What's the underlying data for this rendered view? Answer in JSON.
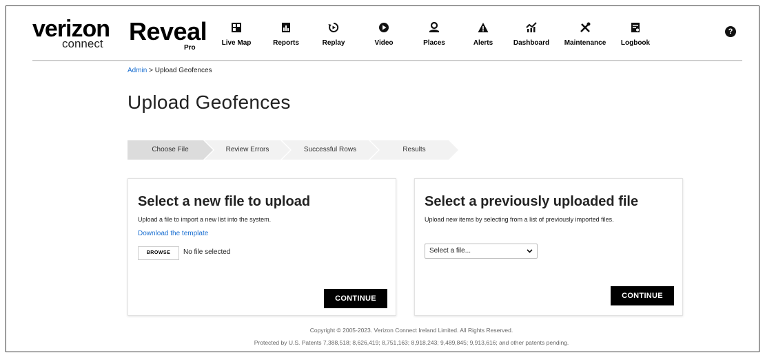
{
  "brand": {
    "verizon": "verizon",
    "connect": "connect",
    "reveal": "Reveal",
    "pro": "Pro"
  },
  "nav": {
    "items": [
      {
        "label": "Live Map",
        "icon": "live-map-icon"
      },
      {
        "label": "Reports",
        "icon": "reports-icon"
      },
      {
        "label": "Replay",
        "icon": "replay-icon"
      },
      {
        "label": "Video",
        "icon": "video-icon"
      },
      {
        "label": "Places",
        "icon": "places-icon"
      },
      {
        "label": "Alerts",
        "icon": "alerts-icon"
      },
      {
        "label": "Dashboard",
        "icon": "dashboard-icon"
      },
      {
        "label": "Maintenance",
        "icon": "maintenance-icon"
      },
      {
        "label": "Logbook",
        "icon": "logbook-icon"
      }
    ],
    "help": "?"
  },
  "breadcrumb": {
    "admin": "Admin",
    "separator": " > ",
    "current": "Upload Geofences"
  },
  "page_title": "Upload Geofences",
  "steps": [
    {
      "label": "Choose File",
      "active": true
    },
    {
      "label": "Review Errors",
      "active": false
    },
    {
      "label": "Successful Rows",
      "active": false
    },
    {
      "label": "Results",
      "active": false
    }
  ],
  "new_file_card": {
    "title": "Select a new file to upload",
    "description": "Upload a file to import a new list into the system.",
    "template_link": "Download the template",
    "browse_label": "BROWSE",
    "file_status": "No file selected",
    "continue_label": "CONTINUE"
  },
  "previous_file_card": {
    "title": "Select a previously uploaded file",
    "description": "Upload new items by selecting from a list of previously imported files.",
    "select_value": "Select a file...",
    "continue_label": "CONTINUE"
  },
  "footer": {
    "copyright": "Copyright © 2005-2023. Verizon Connect Ireland Limited. All Rights Reserved.",
    "patents": "Protected by U.S. Patents 7,388,518; 8,626,419; 8,751,163; 8,918,243; 9,489,845; 9,913,616; and other patents pending."
  },
  "colors": {
    "link": "#1a6fd1",
    "active_step": "#dcdcdc",
    "inactive_step": "#f2f2f2",
    "button": "#000000"
  }
}
